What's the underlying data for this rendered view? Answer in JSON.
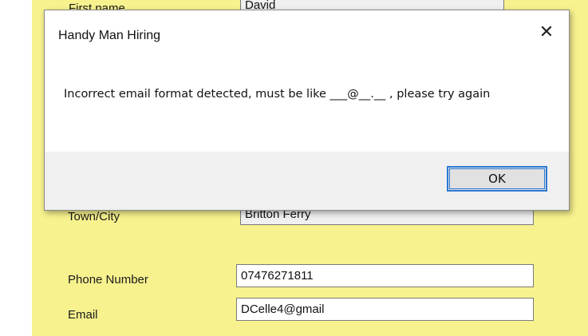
{
  "form": {
    "first_name_label": "First name",
    "first_name_value": "David",
    "town_label": "Town/City",
    "town_value": "Britton Ferry",
    "phone_label": "Phone Number",
    "phone_value": "07476271811",
    "email_label": "Email",
    "email_value": "DCelle4@gmail"
  },
  "dialog": {
    "title": "Handy Man Hiring",
    "close_glyph": "✕",
    "message": "Incorrect email format detected, must be like ___@__.__ , please try again",
    "ok_label": "OK"
  }
}
